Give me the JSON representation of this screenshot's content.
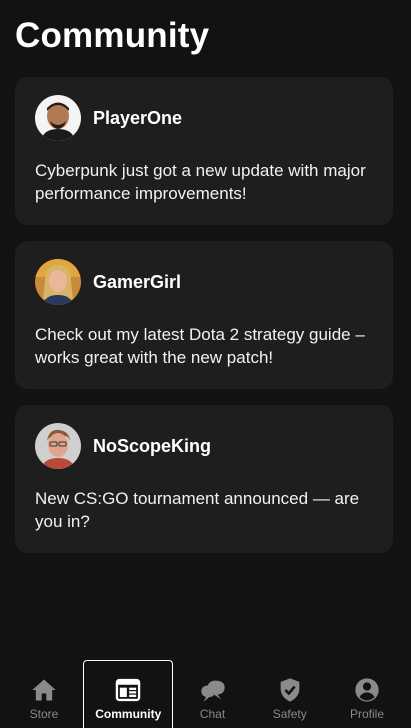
{
  "header": {
    "title": "Community"
  },
  "posts": [
    {
      "user": "PlayerOne",
      "avatar_icon": "user-avatar-playerone",
      "text": "Cyberpunk just got a new update with major performance improvements!"
    },
    {
      "user": "GamerGirl",
      "avatar_icon": "user-avatar-gamergirl",
      "text": "Check out my latest Dota 2 strategy guide – works great with the new patch!"
    },
    {
      "user": "NoScopeKing",
      "avatar_icon": "user-avatar-noscopeking",
      "text": "New CS:GO tournament announced — are you in?"
    }
  ],
  "tabs": [
    {
      "label": "Store",
      "icon": "home-icon",
      "active": false
    },
    {
      "label": "Community",
      "icon": "newspaper-icon",
      "active": true
    },
    {
      "label": "Chat",
      "icon": "chat-bubbles-icon",
      "active": false
    },
    {
      "label": "Safety",
      "icon": "shield-check-icon",
      "active": false
    },
    {
      "label": "Profile",
      "icon": "person-circle-icon",
      "active": false
    }
  ],
  "colors": {
    "background": "#121212",
    "card": "#1e1e1e",
    "inactive_tab": "#8a8a8a",
    "active_tab": "#ffffff"
  }
}
